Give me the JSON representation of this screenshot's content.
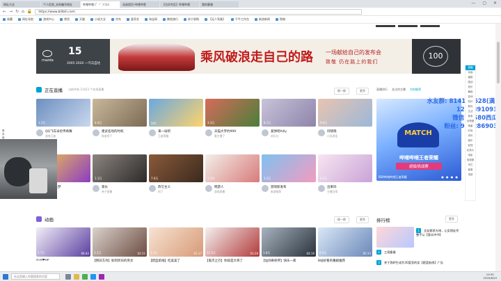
{
  "browser": {
    "tabs": [
      "网址大全",
      "个人信息_叉的编号地址",
      "哔哩哔哩 (゜-゜)つロ",
      "动态首页-哔哩哔哩",
      "【古风专区】哔哩哔哩",
      "我的客服"
    ],
    "active_tab": 2,
    "url": "https://www.bilibili.com",
    "bookmarks": [
      "收藏",
      "网址导航",
      "游戏中心",
      "常用",
      "天猫",
      "小说大全",
      "京东",
      "爱奇艺",
      "淘宝网",
      "携程旅行",
      "苏宁易购",
      "【无人驾驶】",
      "千牛工作台",
      "新浪新闻",
      "购物"
    ]
  },
  "banner": {
    "brand": "mazda",
    "years": "15",
    "years_range": "2005 2020",
    "partner": "一汽马自达",
    "slogan": "乘风破浪走自己的路",
    "launch_line1": "一场献给自己的发布会",
    "launch_line2": "致敬 仍在路上的我们",
    "anniversary": "100",
    "colors": {
      "slogan": "#c11b1b",
      "panel": "#3e4348"
    }
  },
  "live": {
    "title": "正在直播",
    "subtitle": "当前共有 21423 个在线直播",
    "refresh_label": "换一换",
    "more_label": "更多",
    "side_tabs": [
      "直播排行",
      "关注的主播",
      "为你推荐"
    ],
    "cards": [
      {
        "title": "QQ飞车米伦传奇赛",
        "uploader": "游戏王者",
        "count": "1.2万",
        "c1": "#6d8fc0",
        "c2": "#c9d8ee"
      },
      {
        "title": "建武名场的时机",
        "uploader": "陈老师了",
        "count": "4.4万",
        "c1": "#c8b89a",
        "c2": "#7c6b55"
      },
      {
        "title": "来一局吧",
        "uploader": "王者荣耀",
        "count": "505",
        "c1": "#6aa8e0",
        "c2": "#ffd36b"
      },
      {
        "title": "天猫大宇约999",
        "uploader": "看主播了",
        "count": "3.3万",
        "c1": "#d66b5a",
        "c2": "#4a7f3a"
      },
      {
        "title": "爱弹吧Ailly",
        "uploader": "欢乐社",
        "count": "8.1万",
        "c1": "#c9c3d9",
        "c2": "#8e84aa"
      },
      {
        "title": "叼晓晓",
        "uploader": "小话说话",
        "count": "9.8万",
        "c1": "#e9c4b0",
        "c2": "#9bb8d9"
      },
      {
        "title": "梦醒三生梦",
        "uploader": "主播合集",
        "count": "3.3万",
        "c1": "#f4c84a",
        "c2": "#8b3cc4"
      },
      {
        "title": "家长",
        "uploader": "亲子直播",
        "count": "1.1万",
        "c1": "#8b8580",
        "c2": "#2d2a28"
      },
      {
        "title": "改写主义",
        "uploader": "阿了",
        "count": "7.6万",
        "c1": "#8a5a3a",
        "c2": "#3b2a1e"
      },
      {
        "title": "网游人",
        "uploader": "游戏直播",
        "count": "1.3万",
        "c1": "#f3efe8",
        "c2": "#d87b7b"
      },
      {
        "title": "游戏新发布",
        "uploader": "新游推荐",
        "count": "2.2万",
        "c1": "#7fc1f0",
        "c2": "#f39bc0"
      },
      {
        "title": "出来吗",
        "uploader": "主播日常",
        "count": "6.5万",
        "c1": "#f7e6f0",
        "c2": "#c9a3d8"
      }
    ]
  },
  "promo": {
    "match": "MATCH",
    "line1": "哔哩哔哩王者荣耀",
    "line2": "超级挑战赛",
    "caption": "BSM哔哩哔哩王者荣耀",
    "colors": {
      "top": "#d6e8ff",
      "bottom": "#2c5bd6"
    }
  },
  "overlay": {
    "lines": [
      "水友群: 814100628(满)",
      "1225891093",
      "微信: CS80西瓜",
      "粉丝: 916286903"
    ],
    "color": "#2e6ae6"
  },
  "anime": {
    "title": "动画",
    "refresh_label": "换一换",
    "more_label": "更多",
    "cards": [
      {
        "title": "ATR❤HP",
        "views": "1.7万",
        "dur": "00:42",
        "c1": "#f1eef7",
        "c2": "#5b3fa0"
      },
      {
        "title": "【明日方舟】如何听日的英文",
        "views": "3.1万",
        "dur": "02:31",
        "c1": "#d9d2cc",
        "c2": "#6d4c41"
      },
      {
        "title": "【碧蓝航线】吃美美了",
        "views": "1.2万",
        "dur": "01:17",
        "c1": "#f7e3d3",
        "c2": "#d79a77"
      },
      {
        "title": "【鬼灭之刃】你就是大哥了",
        "views": "22.5万",
        "dur": "03:28",
        "c1": "#f3f0f0",
        "c2": "#b33a3a"
      },
      {
        "title": "【仙剑奇侠传】快乐一家",
        "views": "1.8万",
        "dur": "04:10",
        "c1": "#a7b3bf",
        "c2": "#2a323c"
      },
      {
        "title": "B站好看的番剧推荐",
        "views": "6.6万",
        "dur": "05:33",
        "c1": "#d9e8f7",
        "c2": "#6b87b8"
      }
    ]
  },
  "ranking": {
    "title": "排行榜",
    "more_label": "更多",
    "items": [
      {
        "rank": "1",
        "title": "全友都发光线，让女朋友完整不认【冒炎冲冲】"
      },
      {
        "rank": "2",
        "title": "三观看看"
      },
      {
        "rank": "3",
        "title": "关于我转生成为30度恶的女【碧蓝航线】广告"
      }
    ]
  },
  "right_nav": [
    "直播",
    "动画",
    "番剧",
    "国创",
    "音乐",
    "舞蹈",
    "游戏",
    "知识",
    "数码",
    "生活",
    "美食",
    "动物圈",
    "鬼畜",
    "时尚",
    "资讯",
    "娱乐",
    "影视",
    "纪录片",
    "电影",
    "电视剧",
    "专栏",
    "客服",
    "顶部"
  ],
  "left_side": "联系客服",
  "taskbar": {
    "search_placeholder": "在这里输入你要搜索的内容",
    "time": "19:30",
    "date": "2020/8/20"
  }
}
